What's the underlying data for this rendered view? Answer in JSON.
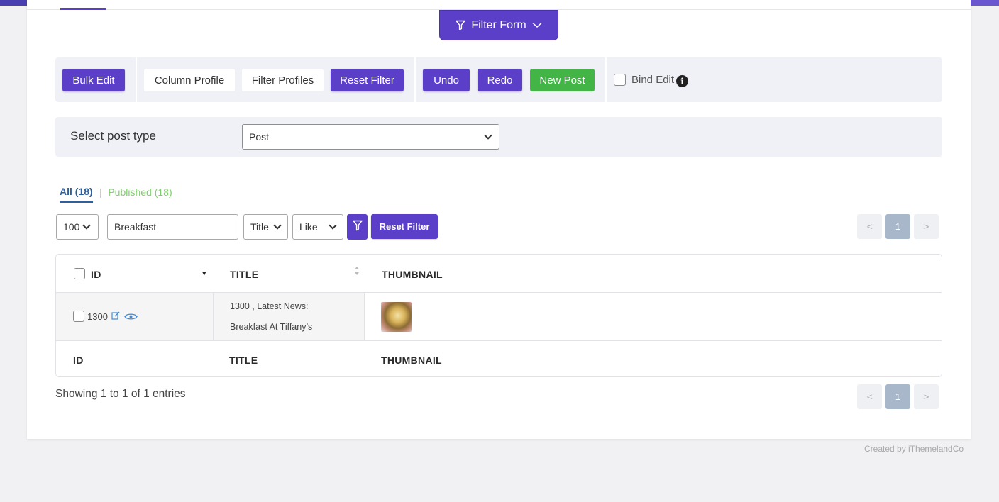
{
  "filter_form": {
    "label": "Filter Form"
  },
  "toolbar": {
    "bulk_edit": "Bulk Edit",
    "column_profile": "Column Profile",
    "filter_profiles": "Filter Profiles",
    "reset_filter": "Reset Filter",
    "undo": "Undo",
    "redo": "Redo",
    "new_post": "New Post",
    "bind_edit": "Bind Edit",
    "info_glyph": "i"
  },
  "post_type": {
    "label": "Select post type",
    "selected": "Post"
  },
  "status_tabs": {
    "all": "All (18)",
    "separator": "|",
    "published": "Published (18)"
  },
  "controls": {
    "per_page": "100",
    "search_value": "Breakfast",
    "field": "Title",
    "operator": "Like",
    "reset_filter": "Reset Filter"
  },
  "pagination": {
    "prev": "<",
    "current": "1",
    "next": ">"
  },
  "table": {
    "headers": [
      "ID",
      "TITLE",
      "THUMBNAIL"
    ],
    "footer_headers": [
      "ID",
      "TITLE",
      "THUMBNAIL"
    ],
    "sort_indicator": "▾",
    "rows": [
      {
        "id": "1300",
        "title_line1": "1300 , Latest News:",
        "title_line2": "Breakfast At Tiffany’s"
      }
    ]
  },
  "entries_info": "Showing 1 to 1 of 1 entries",
  "footer": {
    "credit": "Created by iThemelandCo"
  },
  "colors": {
    "accent": "#5b3fc9",
    "success": "#43b547",
    "tab_active": "#2e5f9e",
    "tab_published": "#7ccf6a"
  }
}
